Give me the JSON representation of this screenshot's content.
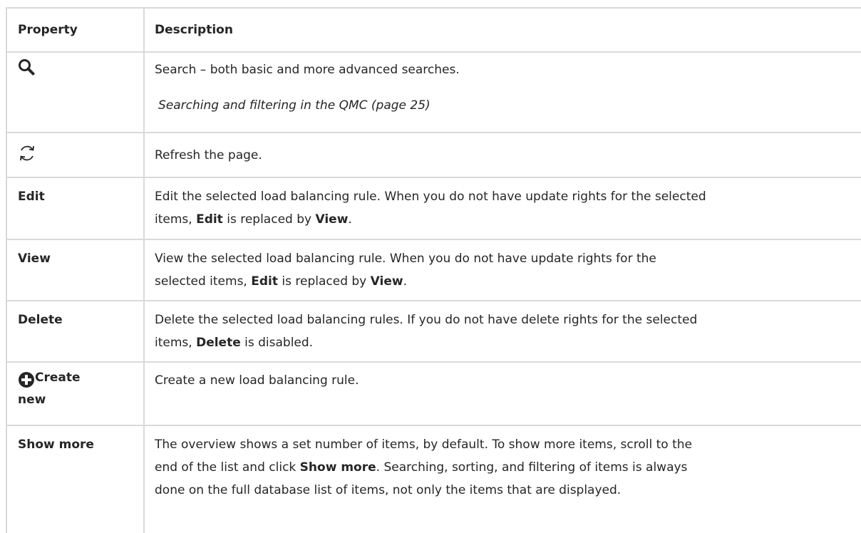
{
  "header": {
    "property": "Property",
    "description": "Description"
  },
  "rows": {
    "search": {
      "icon": "search-icon",
      "desc": "Search – both basic and more advanced searches.",
      "ref": "Searching and filtering in the QMC (page 25)"
    },
    "refresh": {
      "icon": "refresh-icon",
      "desc": "Refresh the page."
    },
    "edit": {
      "label": "Edit",
      "desc_a": "Edit the selected load balancing rule. When you do not have update rights for the selected",
      "desc_b1": "items, ",
      "desc_b2": "Edit",
      "desc_b3": " is replaced by ",
      "desc_b4": "View",
      "desc_b5": "."
    },
    "view": {
      "label": "View",
      "desc_a": "View the selected load balancing rule. When you do not have update rights for the",
      "desc_b1": "selected items, ",
      "desc_b2": "Edit",
      "desc_b3": " is replaced by ",
      "desc_b4": "View",
      "desc_b5": "."
    },
    "delete": {
      "label": "Delete",
      "desc_a": "Delete the selected load balancing rules. If you do not have delete rights for the selected",
      "desc_b1": "items, ",
      "desc_b2": "Delete",
      "desc_b3": " is disabled."
    },
    "create": {
      "icon": "plus-circle-icon",
      "label_a": "Create",
      "label_b": "new",
      "desc": "Create a new load balancing rule."
    },
    "more": {
      "label": "Show more",
      "desc_a": "The overview shows a set number of items, by default. To show more items, scroll to the",
      "desc_b1": "end of the list and click ",
      "desc_b2": "Show more",
      "desc_b3": ". Searching, sorting, and filtering of items is always",
      "desc_c": "done on the full database list of items, not only the items that are displayed."
    }
  }
}
